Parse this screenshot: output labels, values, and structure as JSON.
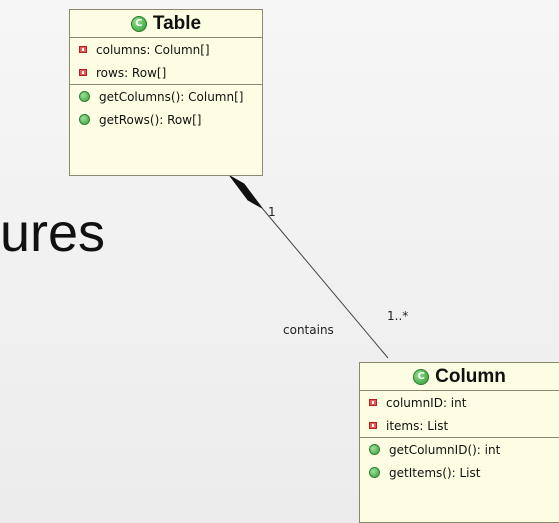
{
  "background_text": "ures",
  "table_class": {
    "name": "Table",
    "attributes": [
      "columns: Column[]",
      "rows: Row[]"
    ],
    "operations": [
      "getColumns(): Column[]",
      "getRows(): Row[]"
    ]
  },
  "column_class": {
    "name": "Column",
    "attributes": [
      "columnID: int",
      "items: List"
    ],
    "operations": [
      "getColumnID(): int",
      "getItems(): List"
    ]
  },
  "association": {
    "label": "contains",
    "source_multiplicity": "1",
    "target_multiplicity": "1..*",
    "type": "composition"
  },
  "colors": {
    "class_fill": "#fdfde3",
    "class_border": "#8a8a6a",
    "attribute_icon": "#e85a5a",
    "operation_icon": "#3aa03a"
  }
}
